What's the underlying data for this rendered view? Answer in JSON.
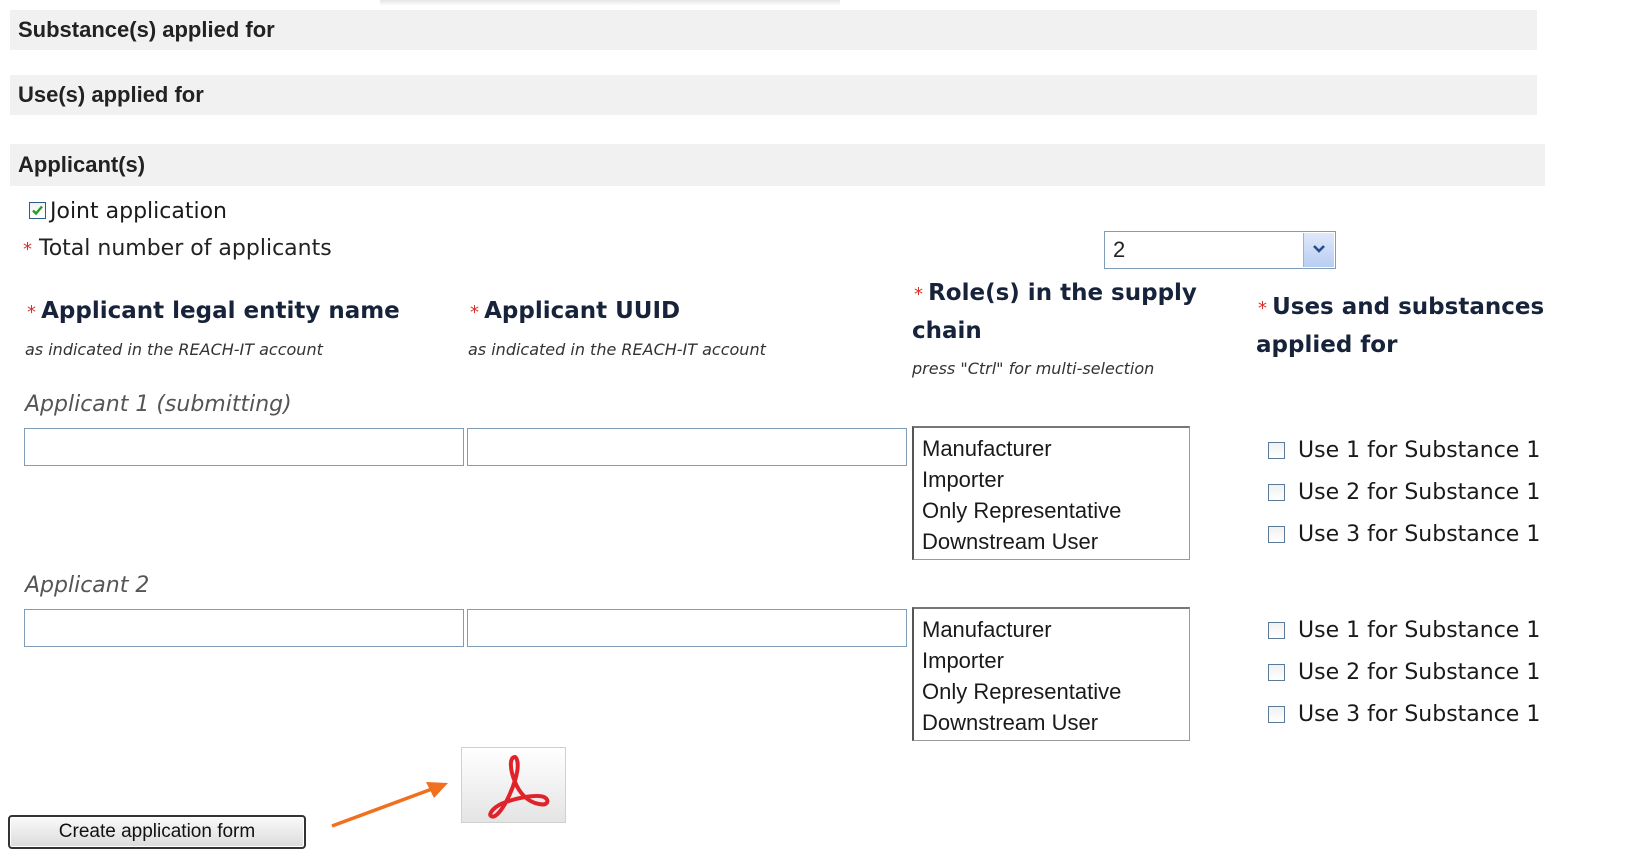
{
  "sections": {
    "substances": "Substance(s) applied for",
    "uses": "Use(s) applied for",
    "applicants": "Applicant(s)"
  },
  "joint_application": {
    "label": "Joint application",
    "checked": true
  },
  "total_applicants": {
    "required_mark": "*",
    "label": "Total number of applicants",
    "value": "2"
  },
  "columns": {
    "name": {
      "required_mark": "*",
      "title": "Applicant legal entity name",
      "hint": "as indicated in the REACH-IT account"
    },
    "uuid": {
      "required_mark": "*",
      "title": "Applicant UUID",
      "hint": "as indicated in the REACH-IT account"
    },
    "role": {
      "required_mark": "*",
      "title_line1": "Role(s) in the supply",
      "title_line2": "chain",
      "hint": "press \"Ctrl\" for multi-selection"
    },
    "uses": {
      "required_mark": "*",
      "title_line1": "Uses and substances",
      "title_line2": "applied for"
    }
  },
  "applicants": [
    {
      "label": "Applicant 1 (submitting)",
      "name_value": "",
      "uuid_value": "",
      "roles": [
        "Manufacturer",
        "Importer",
        "Only Representative",
        "Downstream User"
      ],
      "uses": [
        "Use 1 for Substance 1",
        "Use 2 for Substance 1",
        "Use 3 for Substance 1"
      ]
    },
    {
      "label": "Applicant 2",
      "name_value": "",
      "uuid_value": "",
      "roles": [
        "Manufacturer",
        "Importer",
        "Only Representative",
        "Downstream User"
      ],
      "uses": [
        "Use 1 for Substance 1",
        "Use 2 for Substance 1",
        "Use 3 for Substance 1"
      ]
    }
  ],
  "create_button": "Create application form",
  "icons": {
    "pdf": "adobe-pdf-icon",
    "arrow": "arrow-right-icon"
  },
  "colors": {
    "required": "#d9302c",
    "arrow": "#f07020",
    "pdf": "#e0232a"
  }
}
